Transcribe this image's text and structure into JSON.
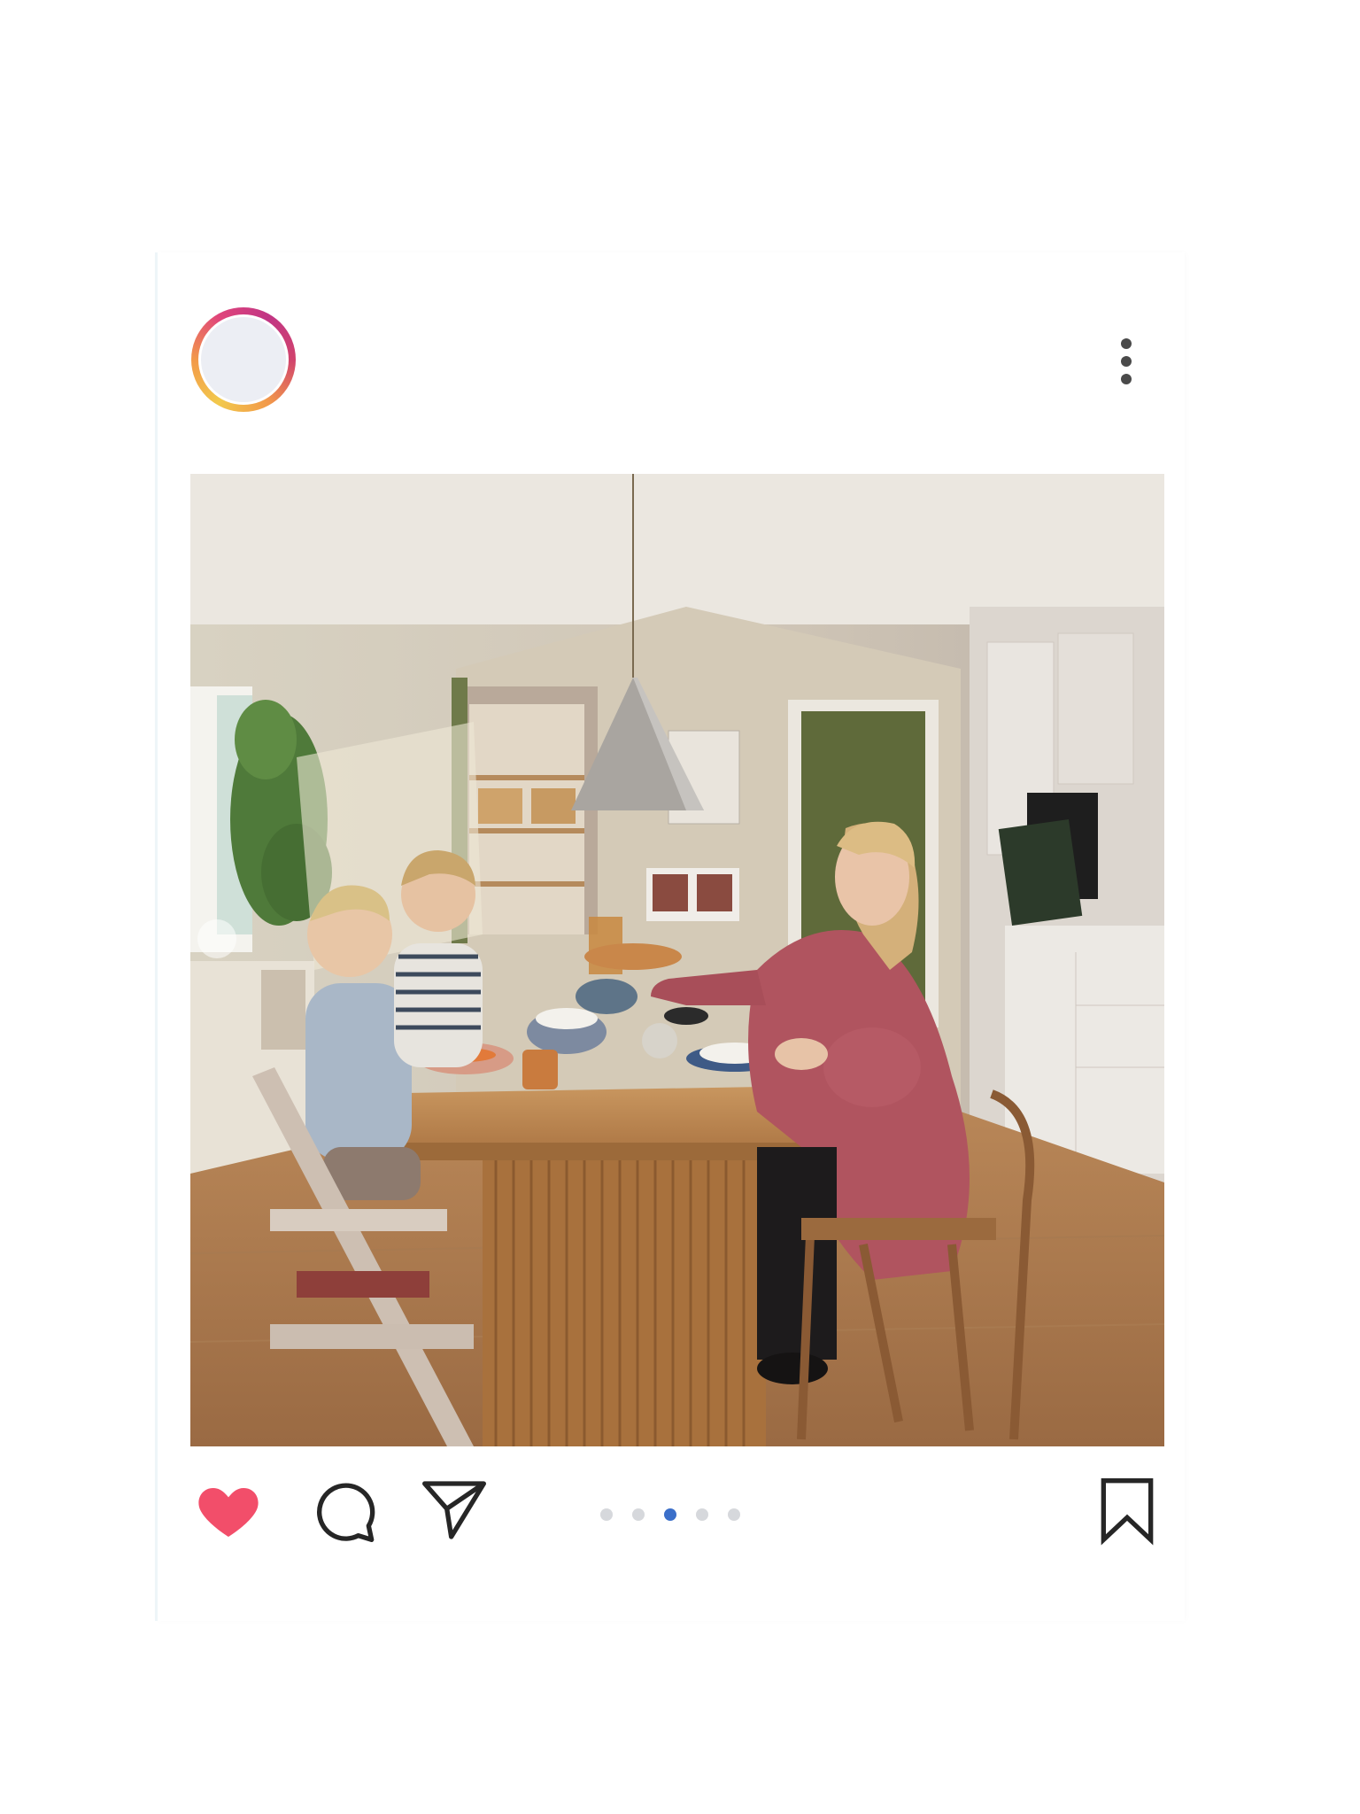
{
  "post": {
    "image": {
      "description_icon": "kitchen-family-photo"
    },
    "header": {
      "avatar_icon": "profile-avatar-icon",
      "more_icon": "more-vertical-icon"
    },
    "actions": {
      "like_icon": "heart-filled-icon",
      "comment_icon": "comment-bubble-icon",
      "share_icon": "paper-plane-icon",
      "save_icon": "bookmark-icon",
      "liked": true
    },
    "carousel": {
      "total_slides": 5,
      "current_slide": 3
    }
  },
  "colors": {
    "like": "#f24e6a",
    "active_dot": "#3b6fc9",
    "inactive_dot": "#d6d8dc",
    "icon_stroke": "#262626"
  }
}
